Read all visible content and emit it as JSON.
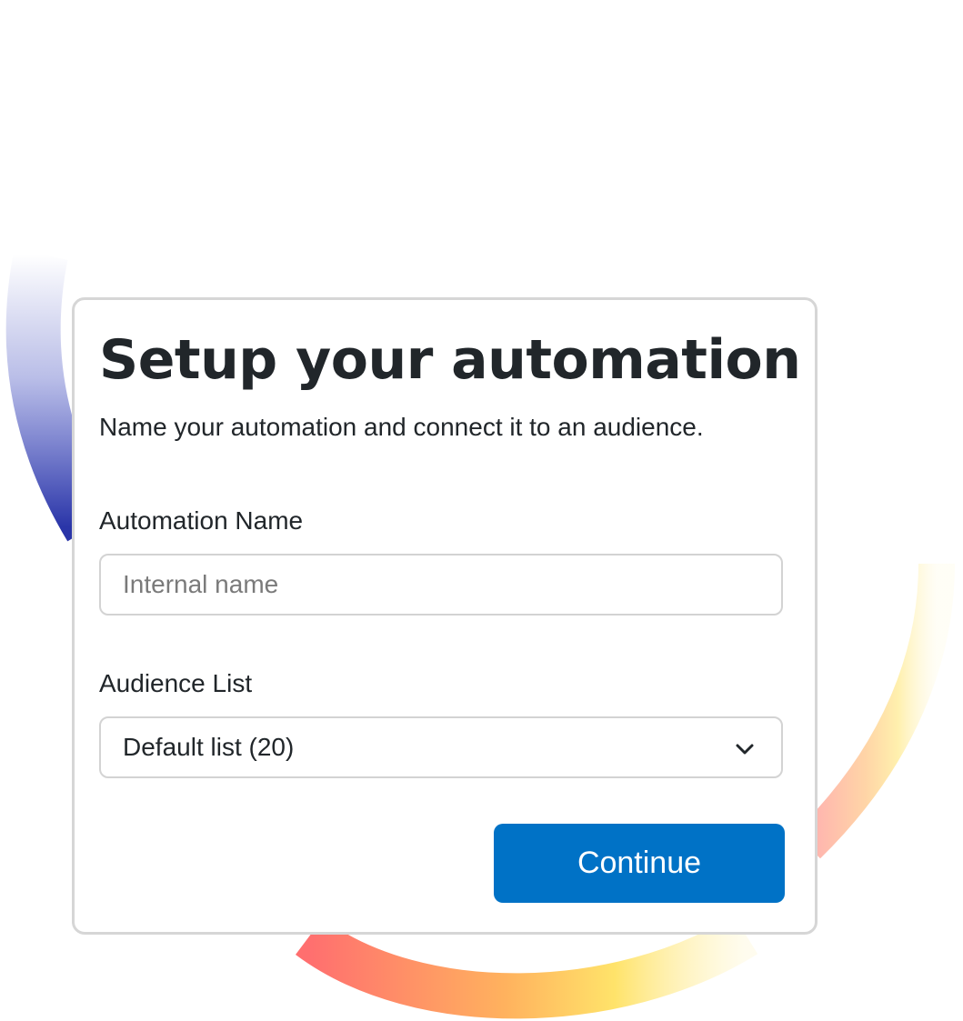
{
  "dialog": {
    "title": "Setup your automation",
    "subtitle": "Name your automation and connect it to an audience."
  },
  "form": {
    "automation_name": {
      "label": "Automation Name",
      "value": "",
      "placeholder": "Internal name"
    },
    "audience_list": {
      "label": "Audience List",
      "selected": "Default list (20)"
    },
    "continue_label": "Continue"
  },
  "icons": {
    "select_arrow": "chevron-down-icon"
  },
  "colors": {
    "primary_button": "#0072c6",
    "card_border": "#d6d6d6",
    "text": "#21262a",
    "ring_gradient": [
      "#2e3ab5",
      "#ff7a6e",
      "#ffe36a",
      "#fff8d6"
    ]
  }
}
